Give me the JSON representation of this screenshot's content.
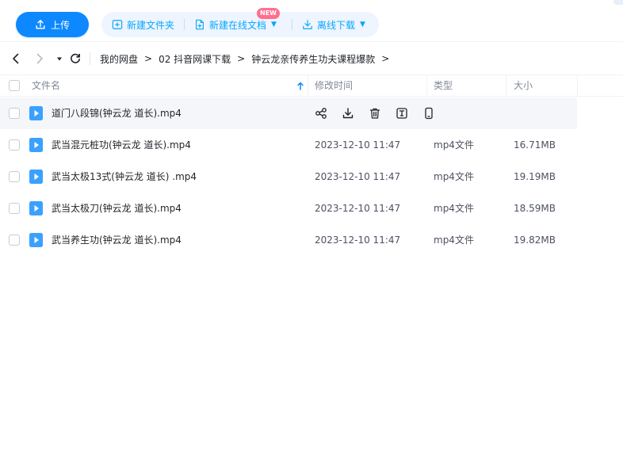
{
  "toolbar": {
    "upload_label": "上传",
    "new_folder_label": "新建文件夹",
    "new_online_doc_label": "新建在线文档",
    "new_badge": "NEW",
    "offline_download_label": "离线下载"
  },
  "nav": {
    "breadcrumb": [
      "我的网盘",
      "02 抖音网课下载",
      "钟云龙亲传养生功夫课程爆款"
    ]
  },
  "table": {
    "columns": {
      "name": "文件名",
      "modified": "修改时间",
      "type": "类型",
      "size": "大小"
    },
    "rows": [
      {
        "name": "道门八段锦(钟云龙 道长).mp4",
        "modified": "",
        "type": "",
        "size": "",
        "hovered": true
      },
      {
        "name": "武当混元桩功(钟云龙 道长).mp4",
        "modified": "2023-12-10 11:47",
        "type": "mp4文件",
        "size": "16.71MB"
      },
      {
        "name": "武当太极13式(钟云龙 道长) .mp4",
        "modified": "2023-12-10 11:47",
        "type": "mp4文件",
        "size": "19.19MB"
      },
      {
        "name": "武当太极刀(钟云龙 道长).mp4",
        "modified": "2023-12-10 11:47",
        "type": "mp4文件",
        "size": "18.59MB"
      },
      {
        "name": "武当养生功(钟云龙 道长).mp4",
        "modified": "2023-12-10 11:47",
        "type": "mp4文件",
        "size": "19.82MB"
      }
    ],
    "row_actions": [
      "share-icon",
      "download-icon",
      "delete-icon",
      "text-extract-icon",
      "phone-icon"
    ]
  },
  "colors": {
    "accent": "#0d88ff",
    "action_text": "#06a7ff",
    "toolbar_group_bg": "#eef5fe",
    "badge": "#ff6f8f",
    "video_icon": "#3aa1ff",
    "hover_row": "#f5f6f9"
  }
}
